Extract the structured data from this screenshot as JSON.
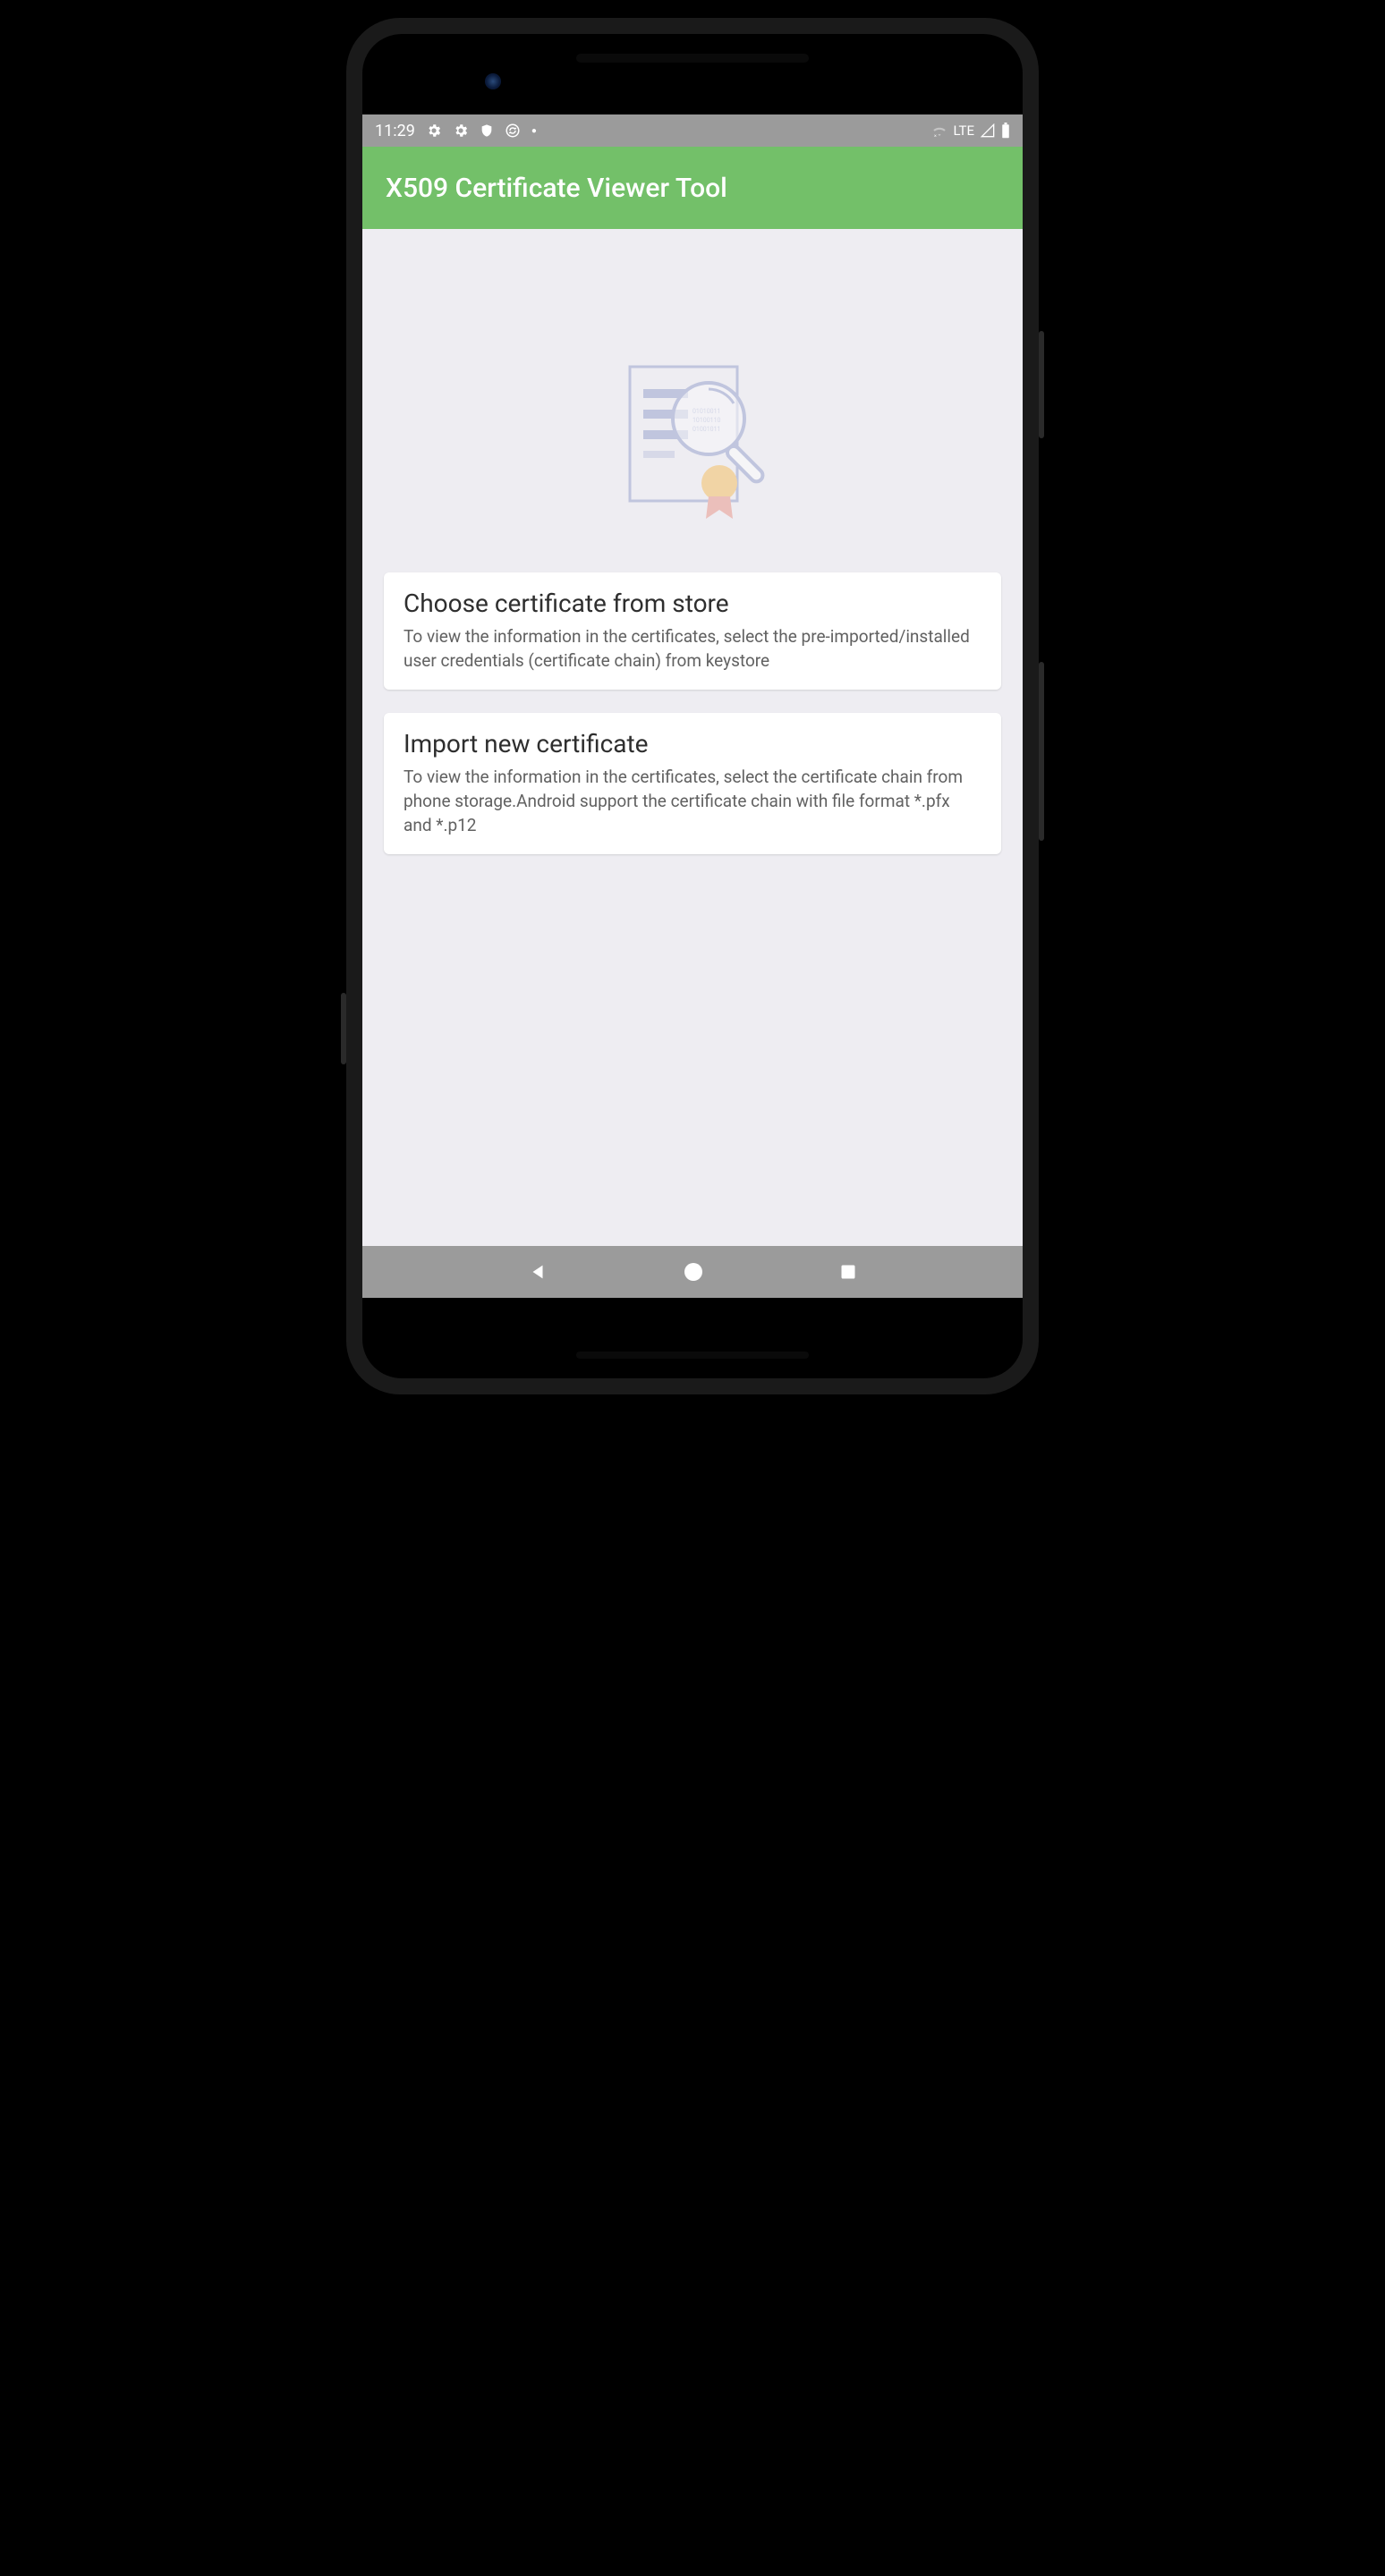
{
  "statusBar": {
    "time": "11:29",
    "network": "LTE"
  },
  "appBar": {
    "title": "X509 Certificate Viewer Tool"
  },
  "cards": [
    {
      "title": "Choose certificate from store",
      "desc": "To view the information in the certificates, select the pre-imported/installed user credentials (certificate chain) from keystore"
    },
    {
      "title": "Import new certificate",
      "desc": "To view the information in the certificates, select the certificate chain from phone storage.Android support the certificate chain with file format *.pfx and *.p12"
    }
  ]
}
